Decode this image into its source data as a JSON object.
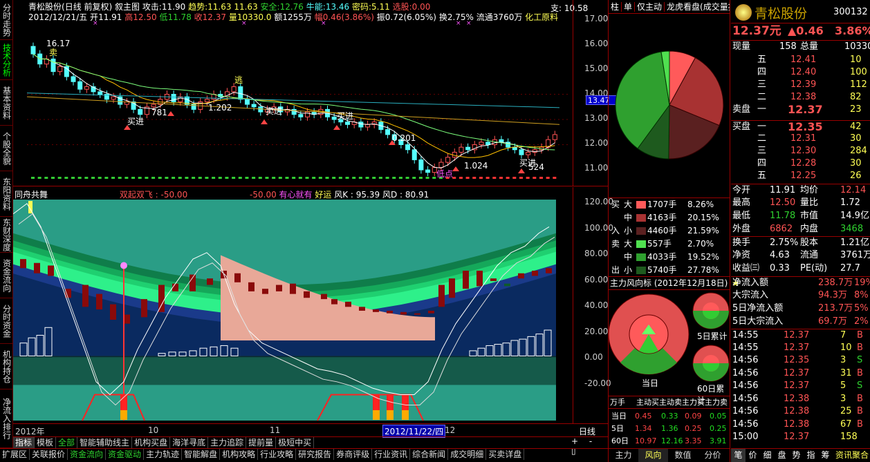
{
  "left_tabs": [
    "分时走势",
    "技术分析",
    "基本资料",
    "个股全貌",
    "东阳资料",
    "东财深度",
    "资金流向",
    "分时资金",
    "机构持仓",
    "净流入排行"
  ],
  "header": {
    "stock": "青松股份",
    "period": "(日线 前复权)",
    "tool": "叙主图",
    "attack_label": "攻击:",
    "attack": "11.90",
    "trend_label": "趋势:",
    "trend": "11.63",
    "safe_val": "11.63",
    "safe_label": "安全:",
    "safe": "12.76",
    "kinetic_label": "牛能:",
    "kinetic": "13.46",
    "pw_label": "密码:",
    "pw": "5.11",
    "sel_label": "选股:",
    "sel": "0.00",
    "resist_label": "支:",
    "resist": "10.58"
  },
  "ohlc": {
    "date": "2012/12/21/五",
    "open_l": "开",
    "open": "11.91",
    "high_l": "高",
    "high": "12.50",
    "low_l": "低",
    "low": "11.78",
    "close_l": "收",
    "close": "12.37",
    "vol_l": "量",
    "vol": "10330.0",
    "amt_l": "额",
    "amt": "1255万",
    "chg_l": "幅",
    "chg": "0.46(3.86%)",
    "amp_l": "振",
    "amp": "0.72(6.05%)",
    "turn_l": "换",
    "turn": "2.75%",
    "float_l": "流通",
    "float": "3760万",
    "ind": "化工原料"
  },
  "price_axis": [
    "17.00",
    "16.00",
    "15.00",
    "14.00",
    "13.00",
    "12.00",
    "11.00"
  ],
  "price_tag": "13.47",
  "chart_annotations": {
    "hi": "16.17",
    "sell1": "卖",
    "buy1": "买进",
    "v1": "781",
    "v2": "1.202",
    "sell2": "逃",
    "sell3": "卖进",
    "buy2": "买进",
    "v3": "0.201",
    "v4": "1.024",
    "buy3": "买进",
    "v5": "524",
    "low_label": "低点"
  },
  "sub_header": {
    "name": "同舟共舞",
    "s1": "双起双飞 : -50.00",
    "s2": "-50.00",
    "s3": "有心就有",
    "s4": "好运",
    "s5": "风K : 95.39",
    "s6": "风D : 80.91"
  },
  "sub_axis": [
    "120.00",
    "100.00",
    "80.00",
    "60.00",
    "40.00",
    "20.00",
    "0.00",
    "-20.00"
  ],
  "x_axis": {
    "a": "2012年",
    "b": "10",
    "c": "11",
    "d": "2012/11/22/四",
    "e": "12"
  },
  "bottom_tabs1": [
    "指标",
    "模板",
    "全部",
    "智能辅助线主",
    "机构买盘",
    "海洋寻底",
    "主力追踪",
    "提前量",
    "极短中买"
  ],
  "bottom_tabs2": [
    "扩展区",
    "关联报价",
    "资金流向",
    "资金驱动",
    "主力轨迹",
    "智能解盘",
    "机构攻略",
    "行业攻略",
    "研究报告",
    "券商评级",
    "行业资讯",
    "综合新闻",
    "成交明细",
    "买卖详盘"
  ],
  "period_label": "日线",
  "right_panel": {
    "tabs": [
      "柱",
      "单",
      "仅主动",
      "龙虎看盘(成交量按"
    ],
    "flow_rows": [
      {
        "side": "买",
        "size": "大",
        "vol": "1707手",
        "pct": "8.26%",
        "color": "#ff5a5a"
      },
      {
        "side": "",
        "size": "中",
        "vol": "4163手",
        "pct": "20.15%",
        "color": "#a83232"
      },
      {
        "side": "入",
        "size": "小",
        "vol": "4460手",
        "pct": "21.59%",
        "color": "#5a2020"
      },
      {
        "side": "卖",
        "size": "大",
        "vol": "557手",
        "pct": "2.70%",
        "color": "#50e050"
      },
      {
        "side": "",
        "size": "中",
        "vol": "4033手",
        "pct": "19.52%",
        "color": "#2fa02f"
      },
      {
        "side": "出",
        "size": "小",
        "vol": "5740手",
        "pct": "27.78%",
        "color": "#1e5a1e"
      }
    ],
    "wind_title": "主力风向标 (2012年12月18日)",
    "wind_labels": [
      "当日",
      "5日累计",
      "60日累计"
    ],
    "table_head": [
      "万手",
      "主动买",
      "主动卖",
      "主力买",
      "主力卖"
    ],
    "table_rows": [
      {
        "k": "当日",
        "a": "0.45",
        "b": "0.33",
        "c": "0.09",
        "d": "0.05"
      },
      {
        "k": "5日",
        "a": "1.34",
        "b": "1.36",
        "c": "0.25",
        "d": "0.25"
      },
      {
        "k": "60日",
        "a": "10.97",
        "b": "12.16",
        "c": "3.35",
        "d": "3.91"
      }
    ],
    "bottom": [
      "主力",
      "风向",
      "数值",
      "分价"
    ]
  },
  "quote": {
    "name": "青松股份",
    "code": "300132",
    "price": "12.37元",
    "chg": "▲0.46",
    "pct": "3.86%",
    "now_l": "现量",
    "now": "158",
    "total_l": "总量",
    "total": "10330",
    "asks": [
      [
        "五",
        "12.41",
        "10"
      ],
      [
        "四",
        "12.40",
        "100"
      ],
      [
        "三",
        "12.39",
        "112"
      ],
      [
        "二",
        "12.38",
        "82"
      ],
      [
        "一",
        "12.37",
        "23"
      ]
    ],
    "ask_label": "卖盘",
    "bid_label": "买盘",
    "bids": [
      [
        "一",
        "12.35",
        "42"
      ],
      [
        "二",
        "12.31",
        "30"
      ],
      [
        "三",
        "12.30",
        "284"
      ],
      [
        "四",
        "12.28",
        "30"
      ],
      [
        "五",
        "12.25",
        "26"
      ]
    ],
    "stats": [
      [
        "今开",
        "11.91",
        "均价",
        "12.14"
      ],
      [
        "最高",
        "12.50",
        "量比",
        "1.72"
      ],
      [
        "最低",
        "11.78",
        "市值",
        "14.9亿"
      ],
      [
        "外盘",
        "6862",
        "内盘",
        "3468"
      ],
      [
        "换手",
        "2.75%",
        "股本",
        "1.21亿"
      ],
      [
        "净资",
        "4.63",
        "流通",
        "3761万"
      ],
      [
        "收益㈢",
        "0.33",
        "PE(动)",
        "27.7"
      ]
    ],
    "flows": [
      [
        "净流入额",
        "238.7万",
        "19%"
      ],
      [
        "大宗流入",
        "94.3万",
        "8%"
      ],
      [
        "5日净流入额",
        "213.7万",
        "5%"
      ],
      [
        "5日大宗流入",
        "69.7万",
        "2%"
      ]
    ],
    "ticks": [
      [
        "14:55",
        "12.37",
        "7",
        "B"
      ],
      [
        "14:55",
        "12.37",
        "10",
        "B"
      ],
      [
        "14:56",
        "12.35",
        "3",
        "S"
      ],
      [
        "14:56",
        "12.37",
        "31",
        "B"
      ],
      [
        "14:56",
        "12.37",
        "5",
        "S"
      ],
      [
        "14:56",
        "12.38",
        "3",
        "B"
      ],
      [
        "14:56",
        "12.38",
        "25",
        "B"
      ],
      [
        "14:56",
        "12.38",
        "67",
        "B"
      ],
      [
        "15:00",
        "12.37",
        "158",
        ""
      ]
    ],
    "foot": [
      "笔",
      "价",
      "细",
      "盘",
      "势",
      "指",
      "筹"
    ],
    "foot_extra": "资讯聚合"
  }
}
